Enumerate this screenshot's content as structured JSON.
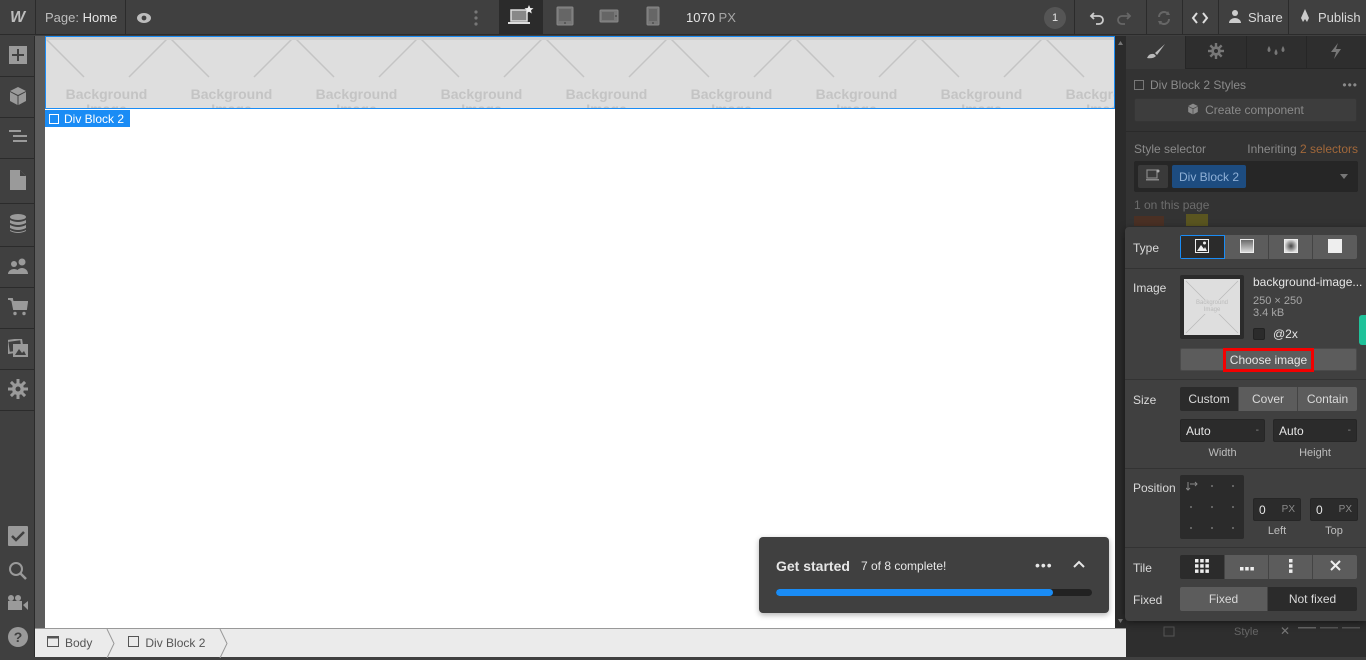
{
  "topbar": {
    "logo": "W",
    "page_prefix": "Page:",
    "page_name": "Home",
    "preview_icon": "eye-icon",
    "more_icon": "vertical-dots-icon",
    "devices": [
      {
        "name": "desktop-base",
        "icon": "laptop-star-icon",
        "active": true
      },
      {
        "name": "tablet",
        "icon": "tablet-icon",
        "active": false
      },
      {
        "name": "mobile-landscape",
        "icon": "phone-landscape-icon",
        "active": false
      },
      {
        "name": "mobile-portrait",
        "icon": "phone-portrait-icon",
        "active": false
      }
    ],
    "width_value": "1070",
    "width_unit": "PX",
    "notification_count": "1",
    "share_label": "Share",
    "publish_label": "Publish"
  },
  "leftbar": {
    "items": [
      {
        "name": "add",
        "icon": "plus-icon"
      },
      {
        "name": "symbols",
        "icon": "cube-icon"
      },
      {
        "name": "navigator",
        "icon": "navigator-icon"
      },
      {
        "name": "pages",
        "icon": "page-icon"
      },
      {
        "name": "cms",
        "icon": "database-icon"
      },
      {
        "name": "users",
        "icon": "users-icon"
      },
      {
        "name": "ecommerce",
        "icon": "cart-icon"
      },
      {
        "name": "assets",
        "icon": "images-icon"
      },
      {
        "name": "settings",
        "icon": "gear-icon"
      }
    ],
    "bottom_items": [
      {
        "name": "audit",
        "icon": "checkbox-icon"
      },
      {
        "name": "search",
        "icon": "search-icon"
      },
      {
        "name": "tutorials",
        "icon": "video-camera-icon"
      },
      {
        "name": "help",
        "icon": "help-icon"
      }
    ]
  },
  "canvas": {
    "tile_line1": "Background",
    "tile_line2": "Image",
    "selected_label": "Div Block 2"
  },
  "breadcrumb": [
    {
      "label": "Body",
      "icon": "body-icon"
    },
    {
      "label": "Div Block 2",
      "icon": "div-block-icon"
    }
  ],
  "getstarted": {
    "title": "Get started",
    "count": "7 of 8 complete!",
    "completed": 7,
    "total": 8
  },
  "rightpanel": {
    "tabs": [
      {
        "name": "style",
        "icon": "brush-icon",
        "active": true
      },
      {
        "name": "settings",
        "icon": "gear-icon",
        "active": false
      },
      {
        "name": "swatches",
        "icon": "drops-icon",
        "active": false
      },
      {
        "name": "interactions",
        "icon": "lightning-icon",
        "active": false
      }
    ],
    "styles_title": "Div Block 2 Styles",
    "create_component": "Create component",
    "style_selector_label": "Style selector",
    "inheriting_prefix": "Inheriting",
    "inheriting_count": "2 selectors",
    "selector_chip": "Div Block 2",
    "on_page": "1 on this page"
  },
  "background_popup": {
    "type_label": "Type",
    "type_options": [
      {
        "name": "image",
        "icon": "image-icon",
        "active": true
      },
      {
        "name": "linear-gradient",
        "icon": "linear-gradient-icon",
        "active": false
      },
      {
        "name": "radial-gradient",
        "icon": "radial-gradient-icon",
        "active": false
      },
      {
        "name": "color-overlay",
        "icon": "color-overlay-icon",
        "active": false
      }
    ],
    "image_label": "Image",
    "image_name": "background-image...",
    "image_dims": "250 × 250",
    "image_size": "3.4 kB",
    "thumb_line1": "Background",
    "thumb_line2": "Image",
    "retina_label": "@2x",
    "choose_image": "Choose image",
    "size_label": "Size",
    "size_options": [
      {
        "label": "Custom",
        "active": true
      },
      {
        "label": "Cover",
        "active": false
      },
      {
        "label": "Contain",
        "active": false
      }
    ],
    "width_value": "Auto",
    "width_unit": "-",
    "width_label": "Width",
    "height_value": "Auto",
    "height_unit": "-",
    "height_label": "Height",
    "position_label": "Position",
    "left_value": "0",
    "left_unit": "PX",
    "left_label": "Left",
    "top_value": "0",
    "top_unit": "PX",
    "top_label": "Top",
    "tile_label": "Tile",
    "tile_options": [
      {
        "name": "repeat",
        "icon": "grid-icon",
        "active": true
      },
      {
        "name": "repeat-x",
        "icon": "horizontal-dots-icon",
        "active": false
      },
      {
        "name": "repeat-y",
        "icon": "vertical-dots-icon",
        "active": false
      },
      {
        "name": "no-repeat",
        "icon": "x-icon",
        "active": false
      }
    ],
    "fixed_label": "Fixed",
    "fixed_options": [
      {
        "label": "Fixed",
        "active": false
      },
      {
        "label": "Not fixed",
        "active": true
      }
    ],
    "behind_style_label": "Style"
  }
}
